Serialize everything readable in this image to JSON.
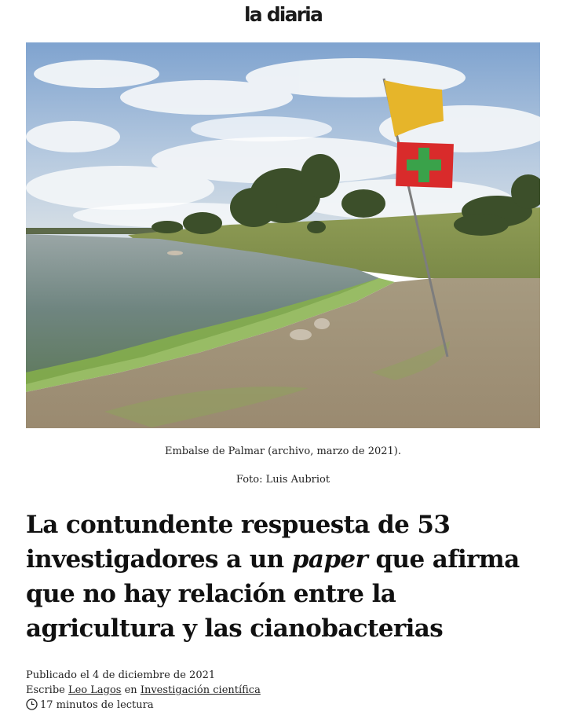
{
  "header": {
    "logo_text": "la diaria"
  },
  "hero": {
    "colors": {
      "sky": "#8fb0d6",
      "cloud": "#eef2f7",
      "water": "#7a8f8c",
      "algae": "#86b04a",
      "grass": "#8a9a52",
      "sand": "#a8997f",
      "flag_yellow": "#e6b52a",
      "flag_red": "#d92b2b",
      "cross_green": "#3aa24a"
    }
  },
  "caption": {
    "line1": "Embalse de Palmar (archivo, marzo de 2021).",
    "line2": "Foto: Luis Aubriot"
  },
  "headline": {
    "part1": "La contundente respuesta de 53 investigadores a un ",
    "emphasis": "paper",
    "part2": " que afirma que no hay relación entre la agricultura y las cianobacterias"
  },
  "meta": {
    "published": "Publicado el 4 de diciembre de 2021",
    "byline_prefix": "Escribe ",
    "author": "Leo Lagos",
    "byline_middle": " en ",
    "section": "Investigación científica",
    "reading_time": "17 minutos de lectura",
    "clock_icon": "clock-icon"
  }
}
